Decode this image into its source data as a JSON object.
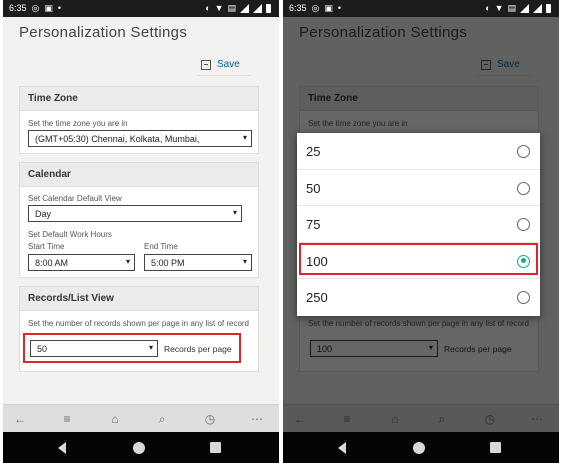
{
  "status_bar": {
    "time": "6:35"
  },
  "page": {
    "title": "Personalization Settings",
    "save_label": "Save"
  },
  "time_zone": {
    "heading": "Time Zone",
    "label": "Set the time zone you are in",
    "value": "(GMT+05:30) Chennai, Kolkata, Mumbai,"
  },
  "calendar": {
    "heading": "Calendar",
    "default_view_label": "Set Calendar Default View",
    "default_view_value": "Day",
    "work_hours_label": "Set Default Work Hours",
    "start_label": "Start Time",
    "start_value": "8:00 AM",
    "end_label": "End Time",
    "end_value": "5:00 PM"
  },
  "records": {
    "heading": "Records/List View",
    "label": "Set the number of records shown per page in any list of record",
    "value_left": "50",
    "value_right": "100",
    "suffix": "Records per page"
  },
  "picker": {
    "options": [
      "25",
      "50",
      "75",
      "100",
      "250"
    ],
    "selected": "100",
    "accent_color": "#15a892"
  },
  "highlight_color": "#e0262b",
  "bottom_nav": {
    "icons": [
      "back-arrow-icon",
      "menu-icon",
      "home-icon",
      "search-icon",
      "activity-icon",
      "more-icon"
    ]
  }
}
